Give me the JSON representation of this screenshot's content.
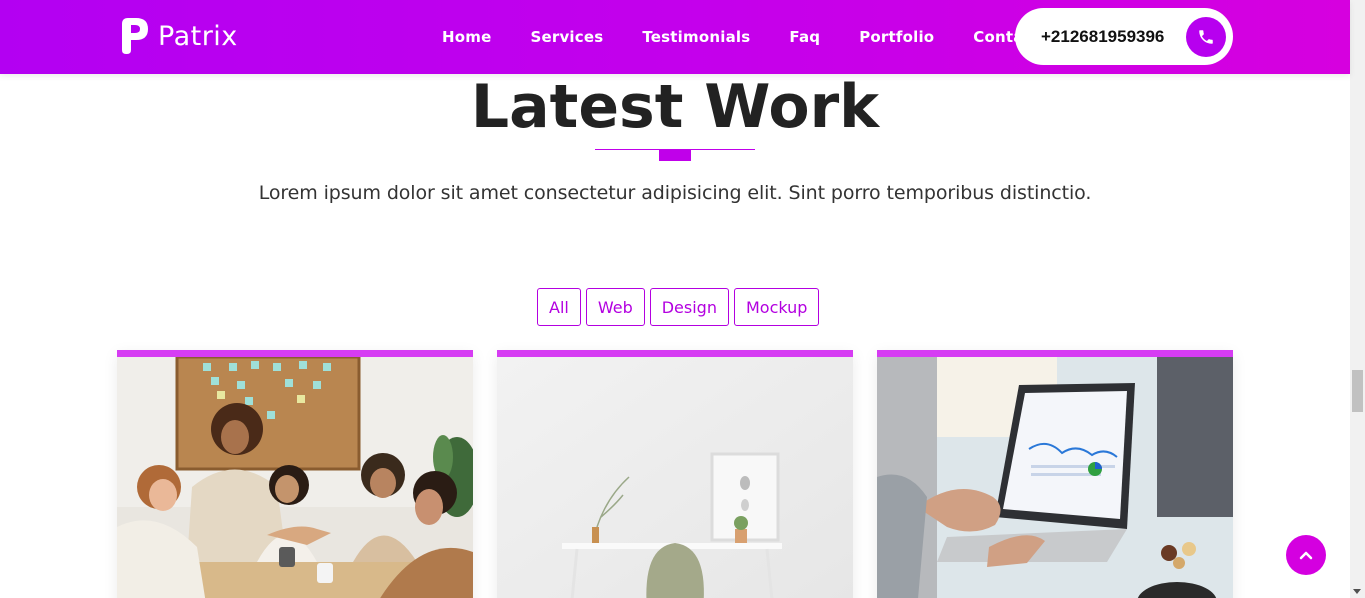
{
  "header": {
    "logo_text": "Patrix",
    "nav": [
      "Home",
      "Services",
      "Testimonials",
      "Faq",
      "Portfolio",
      "Contact"
    ],
    "phone": "+212681959396",
    "gradient_start": "#b300f2",
    "gradient_end": "#d600df"
  },
  "section": {
    "title": "Latest Work",
    "description": "Lorem ipsum dolor sit amet consectetur adipisicing elit. Sint porro temporibus distinctio."
  },
  "filters": [
    "All",
    "Web",
    "Design",
    "Mockup"
  ],
  "cards": [
    {
      "image": "team-meeting-handshake-photo"
    },
    {
      "image": "minimal-desk-chair-photo"
    },
    {
      "image": "laptop-analytics-photo"
    }
  ],
  "colors": {
    "accent": "#c000ea",
    "card_bar": "#d63cf3",
    "to_top": "#d400e0"
  },
  "icons": {
    "phone": "phone-icon",
    "to_top": "chevron-up-icon"
  }
}
